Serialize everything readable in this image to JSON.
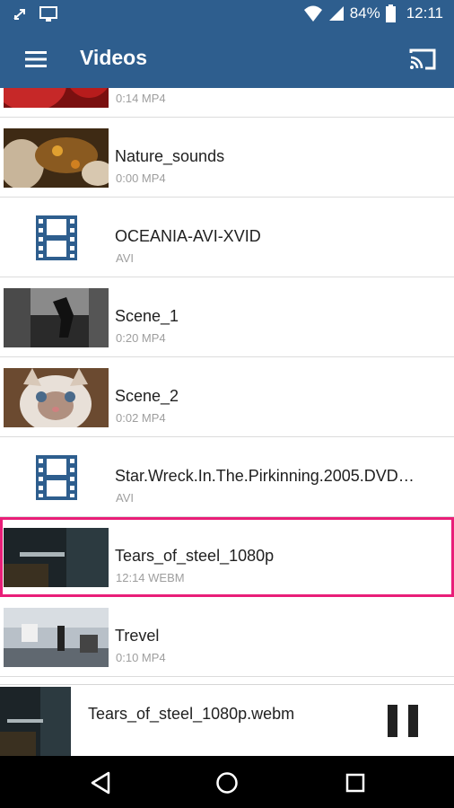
{
  "status_bar": {
    "battery": "84%",
    "time": "12:11"
  },
  "app_bar": {
    "title": "Videos"
  },
  "videos": [
    {
      "name": "",
      "meta": "0:14 MP4",
      "thumb": "red-clip"
    },
    {
      "name": "Nature_sounds",
      "meta": "0:00 MP4",
      "thumb": "nature"
    },
    {
      "name": "OCEANIA-AVI-XVID",
      "meta": "AVI",
      "thumb": "film-icon"
    },
    {
      "name": "Scene_1",
      "meta": "0:20 MP4",
      "thumb": "city"
    },
    {
      "name": "Scene_2",
      "meta": "0:02 MP4",
      "thumb": "cat"
    },
    {
      "name": "Star.Wreck.In.The.Pirkinning.2005.DVD…",
      "meta": "AVI",
      "thumb": "film-icon"
    },
    {
      "name": "Tears_of_steel_1080p",
      "meta": "12:14 WEBM",
      "thumb": "tears",
      "selected": true
    },
    {
      "name": "Trevel",
      "meta": "0:10 MP4",
      "thumb": "office"
    }
  ],
  "mini_player": {
    "title": "Tears_of_steel_1080p.webm"
  },
  "colors": {
    "primary": "#2e5e8e",
    "selection": "#e91e78",
    "film_icon": "#2e5e8e"
  }
}
